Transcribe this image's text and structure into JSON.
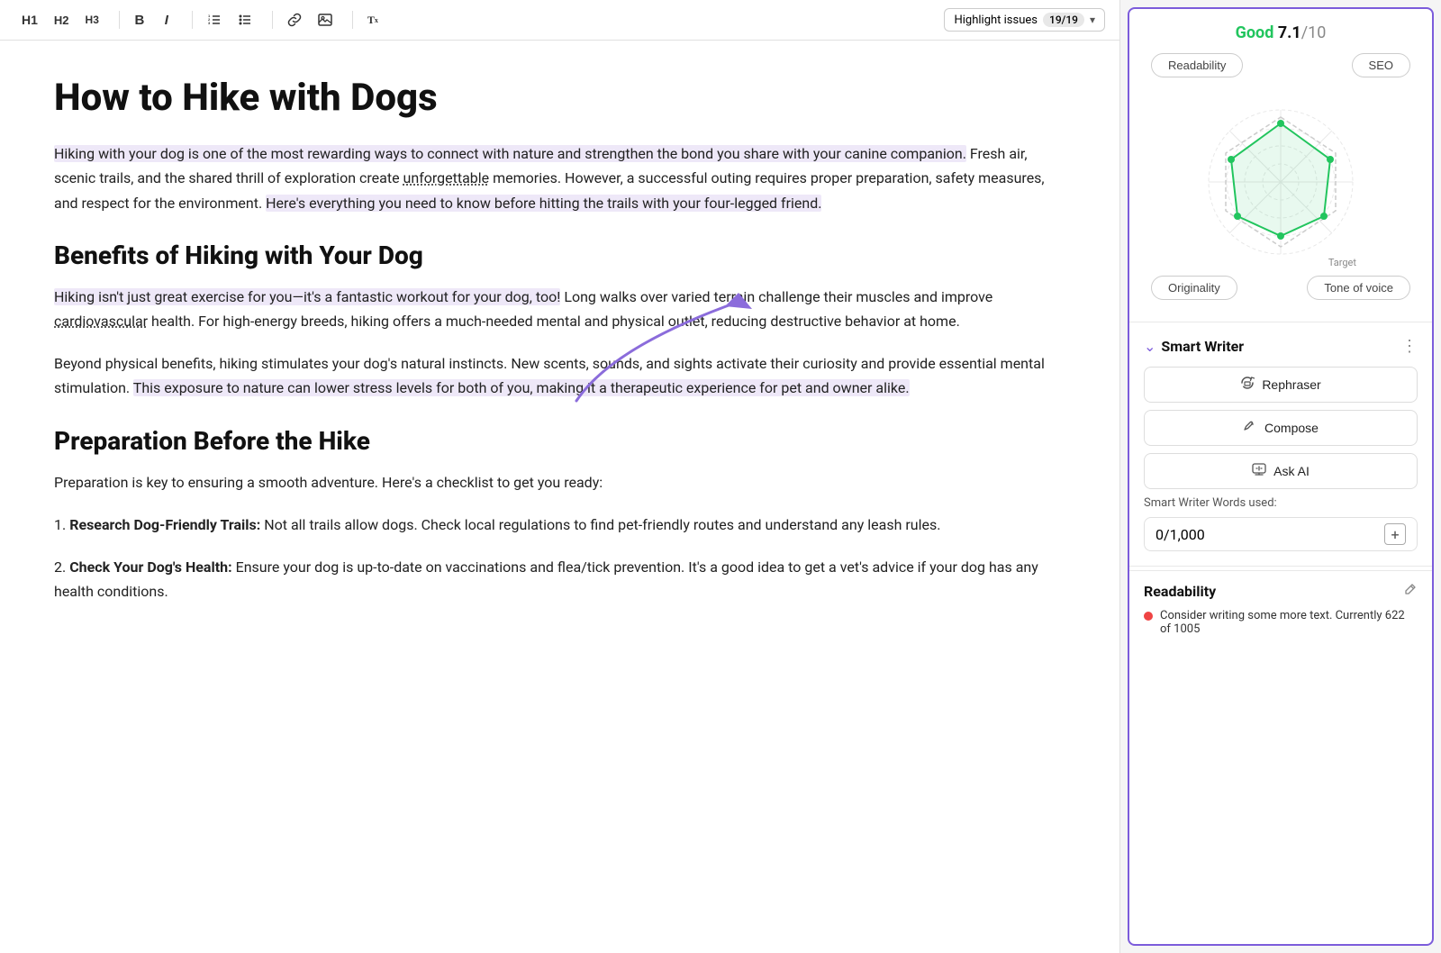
{
  "toolbar": {
    "h1_label": "H1",
    "h2_label": "H2",
    "h3_label": "H3",
    "bold_label": "B",
    "italic_label": "I",
    "ol_icon": "≡",
    "ul_icon": "≡",
    "link_icon": "🔗",
    "image_icon": "🖼",
    "clear_icon": "Tx",
    "highlight_label": "Highlight issues",
    "highlight_count": "19/19",
    "menu_icon": "☰"
  },
  "editor": {
    "title": "How to Hike with Dogs",
    "para1": "Hiking with your dog is one of the most rewarding ways to connect with nature and strengthen the bond you share with your canine companion. Fresh air, scenic trails, and the shared thrill of exploration create unforgettable memories. However, a successful outing requires proper preparation, safety measures, and respect for the environment. Here's everything you need to know before hitting the trails with your four-legged friend.",
    "h2_1": "Benefits of Hiking with Your Dog",
    "para2": "Hiking isn't just great exercise for you—it's a fantastic workout for your dog, too! Long walks over varied terrain challenge their muscles and improve cardiovascular health. For high-energy breeds, hiking offers a much-needed mental and physical outlet, reducing destructive behavior at home.",
    "para3": "Beyond physical benefits, hiking stimulates your dog's natural instincts. New scents, sounds, and sights activate their curiosity and provide essential mental stimulation. This exposure to nature can lower stress levels for both of you, making it a therapeutic experience for pet and owner alike.",
    "h2_2": "Preparation Before the Hike",
    "para4": "Preparation is key to ensuring a smooth adventure. Here's a checklist to get you ready:",
    "list_item1_bold": "Research Dog-Friendly Trails:",
    "list_item1_text": " Not all trails allow dogs. Check local regulations to find pet-friendly routes and understand any leash rules.",
    "list_item2_bold": "Check Your Dog's Health:",
    "list_item2_text": " Ensure your dog is up-to-date on vaccinations and flea/tick prevention. It's a good idea to get a vet's advice if your dog has any health conditions."
  },
  "sidebar": {
    "score_label": "Good",
    "score_value": "7.1",
    "score_max": "/10",
    "tab_readability": "Readability",
    "tab_seo": "SEO",
    "tab_originality": "Originality",
    "tab_tone": "Tone of voice",
    "target_label": "Target",
    "smart_writer_title": "Smart Writer",
    "btn_rephraser": "Rephraser",
    "btn_compose": "Compose",
    "btn_ask_ai": "Ask AI",
    "words_used_label": "Smart Writer Words used:",
    "words_count": "0",
    "words_total": "/1,000",
    "readability_title": "Readability",
    "readability_item": "Consider writing some more text. Currently 622 of 1005"
  }
}
